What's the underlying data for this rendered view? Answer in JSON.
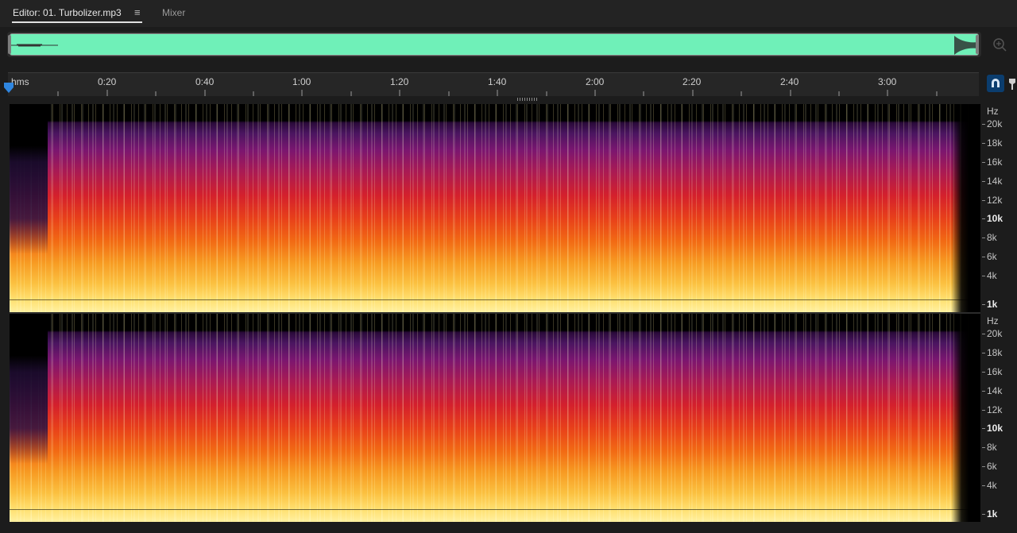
{
  "tabs": {
    "editor_label": "Editor: 01. Turbolizer.mp3",
    "menu_glyph": "≡",
    "mixer_label": "Mixer"
  },
  "timeline": {
    "unit_label": "hms",
    "ticks": [
      "0:20",
      "0:40",
      "1:00",
      "1:20",
      "1:40",
      "2:00",
      "2:20",
      "2:40",
      "3:00"
    ]
  },
  "frequency_axis": {
    "unit": "Hz",
    "labels": [
      "20k",
      "18k",
      "16k",
      "14k",
      "12k",
      "10k",
      "8k",
      "6k",
      "4k",
      "1k"
    ]
  },
  "colors": {
    "overview_wave": "#6ff0b8",
    "playhead": "#2f86e0",
    "snap_button": "#0b3d6e"
  },
  "icons": {
    "zoom": "zoom-icon",
    "playhead": "playhead-marker-icon",
    "snap": "snap-magnet-icon",
    "marker": "marker-pin-icon"
  }
}
